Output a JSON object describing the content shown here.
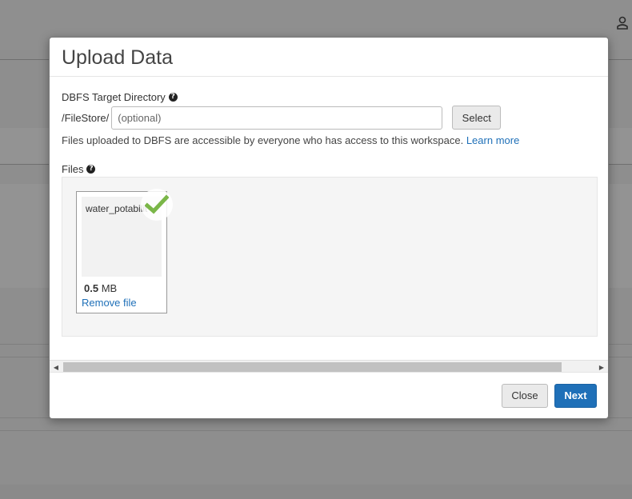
{
  "modal": {
    "title": "Upload Data",
    "target_directory": {
      "label": "DBFS Target Directory",
      "prefix": "/FileStore/",
      "placeholder": "(optional)",
      "value": "",
      "select_label": "Select"
    },
    "hint": {
      "text": "Files uploaded to DBFS are accessible by everyone who has access to this workspace.",
      "link_text": "Learn more"
    },
    "files": {
      "label": "Files",
      "items": [
        {
          "name": "water_potability.csv",
          "size_value": "0.5",
          "size_unit": "MB",
          "remove_label": "Remove file",
          "status": "uploaded"
        }
      ]
    },
    "footer": {
      "close_label": "Close",
      "next_label": "Next"
    }
  },
  "colors": {
    "primary": "#1f70b8",
    "success_check": "#7ab648",
    "overlay": "#8e8e8e"
  }
}
